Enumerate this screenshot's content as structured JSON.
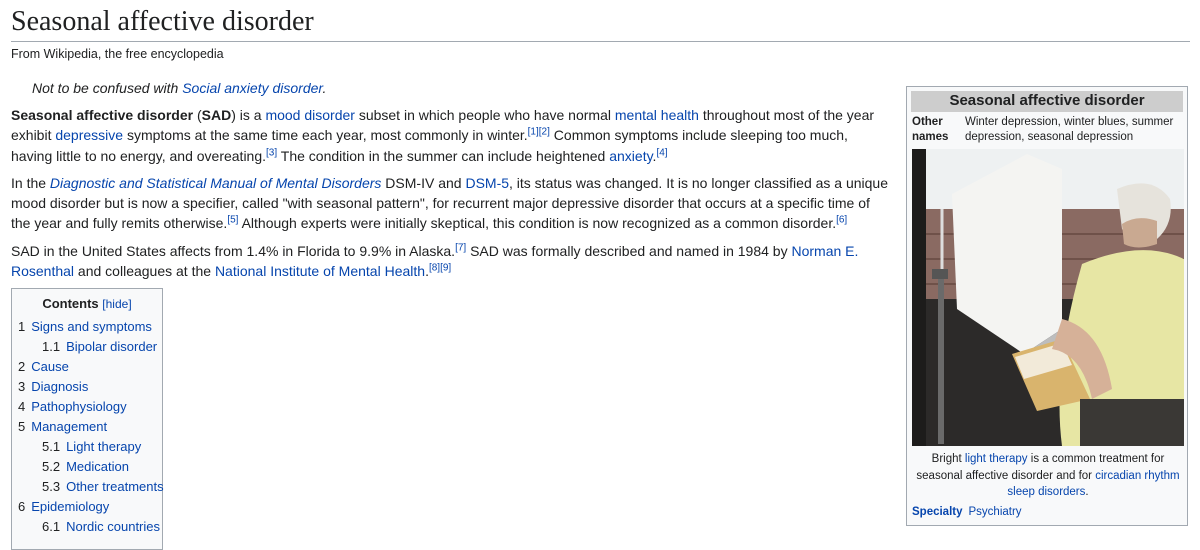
{
  "article": {
    "title": "Seasonal affective disorder",
    "tagline": "From Wikipedia, the free encyclopedia",
    "hatnote_prefix": "Not to be confused with ",
    "hatnote_link": "Social anxiety disorder",
    "hatnote_suffix": "."
  },
  "paragraphs": {
    "p1": {
      "bold1": "Seasonal affective disorder",
      "t1": " (",
      "bold2": "SAD",
      "t2": ") is a ",
      "link1": "mood disorder",
      "t3": " subset in which people who have normal ",
      "link2": "mental health",
      "t4": " throughout most of the year exhibit ",
      "link3": "depressive",
      "t5": " symptoms at the same time each year, most commonly in winter.",
      "ref1": "[1]",
      "ref2": "[2]",
      "t6": " Common symptoms include sleeping too much, having little to no energy, and overeating.",
      "ref3": "[3]",
      "t7": " The condition in the summer can include heightened ",
      "link4": "anxiety",
      "t8": ".",
      "ref4": "[4]"
    },
    "p2": {
      "t1": "In the ",
      "link1": "Diagnostic and Statistical Manual of Mental Disorders",
      "t2": " DSM-IV and ",
      "link2": "DSM-5",
      "t3": ", its status was changed. It is no longer classified as a unique mood disorder but is now a specifier, called \"with seasonal pattern\", for recurrent major depressive disorder that occurs at a specific time of the year and fully remits otherwise.",
      "ref5": "[5]",
      "t4": " Although experts were initially skeptical, this condition is now recognized as a common disorder.",
      "ref6": "[6]"
    },
    "p3": {
      "t1": "SAD in the United States affects from 1.4% in Florida to 9.9% in Alaska.",
      "ref7": "[7]",
      "t2": " SAD was formally described and named in 1984 by ",
      "link1": "Norman E. Rosenthal",
      "t3": " and colleagues at the ",
      "link2": "National Institute of Mental Health",
      "t4": ".",
      "ref8": "[8]",
      "ref9": "[9]"
    }
  },
  "toc": {
    "title": "Contents",
    "hide_label": "[hide]",
    "items": [
      {
        "num": "1",
        "label": "Signs and symptoms"
      },
      {
        "num": "1.1",
        "label": "Bipolar disorder"
      },
      {
        "num": "2",
        "label": "Cause"
      },
      {
        "num": "3",
        "label": "Diagnosis"
      },
      {
        "num": "4",
        "label": "Pathophysiology"
      },
      {
        "num": "5",
        "label": "Management"
      },
      {
        "num": "5.1",
        "label": "Light therapy"
      },
      {
        "num": "5.2",
        "label": "Medication"
      },
      {
        "num": "5.3",
        "label": "Other treatments"
      },
      {
        "num": "6",
        "label": "Epidemiology"
      },
      {
        "num": "6.1",
        "label": "Nordic countries"
      }
    ]
  },
  "infobox": {
    "title": "Seasonal affective disorder",
    "other_names_label_1": "Other",
    "other_names_label_2": "names",
    "other_names_value": "Winter depression, winter blues, summer depression, seasonal depression",
    "caption_t1": "Bright ",
    "caption_link1": "light therapy",
    "caption_t2": " is a common treatment for seasonal affective disorder and for ",
    "caption_link2": "circadian rhythm sleep disorders",
    "caption_t3": ".",
    "specialty_label": "Specialty",
    "specialty_value": "Psychiatry"
  },
  "colors": {
    "link": "#0645ad",
    "text": "#202122",
    "border": "#a2a9b1",
    "infobox_bg": "#f8f9fa",
    "infobox_header": "#cdcdcd"
  }
}
